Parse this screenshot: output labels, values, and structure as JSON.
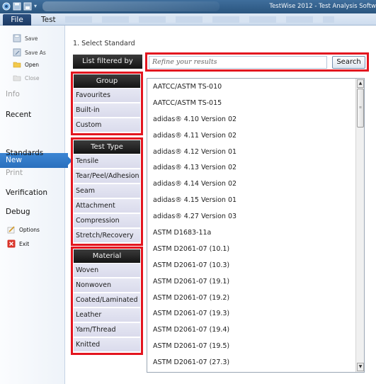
{
  "window": {
    "title": "TestWise 2012 - Test Analysis Softw"
  },
  "tabs": {
    "file": "File",
    "test": "Test"
  },
  "nav": {
    "save": "Save",
    "save_as": "Save As",
    "open": "Open",
    "close": "Close",
    "info": "Info",
    "recent": "Recent",
    "new": "New",
    "standards": "Standards",
    "print": "Print",
    "verification": "Verification",
    "debug": "Debug",
    "options": "Options",
    "exit": "Exit"
  },
  "main": {
    "section_title": "1. Select Standard",
    "filter_label": "List filtered by",
    "search_placeholder": "Refine your results",
    "search_button": "Search"
  },
  "filters": {
    "group": {
      "title": "Group",
      "items": [
        "Favourites",
        "Built-in",
        "Custom"
      ]
    },
    "test_type": {
      "title": "Test Type",
      "items": [
        "Tensile",
        "Tear/Peel/Adhesion",
        "Seam",
        "Attachment",
        "Compression",
        "Stretch/Recovery"
      ]
    },
    "material": {
      "title": "Material",
      "items": [
        "Woven",
        "Nonwoven",
        "Coated/Laminated",
        "Leather",
        "Yarn/Thread",
        "Knitted"
      ]
    }
  },
  "standards_list": [
    "AATCC/ASTM TS-010",
    "AATCC/ASTM TS-015",
    "adidas® 4.10 Version 02",
    "adidas® 4.11 Version 02",
    "adidas® 4.12 Version 01",
    "adidas® 4.13 Version 02",
    "adidas® 4.14 Version 02",
    "adidas® 4.15 Version 01",
    "adidas® 4.27 Version 03",
    "ASTM D1683-11a",
    "ASTM D2061-07 (10.1)",
    "ASTM D2061-07 (10.3)",
    "ASTM D2061-07 (19.1)",
    "ASTM D2061-07 (19.2)",
    "ASTM D2061-07 (19.3)",
    "ASTM D2061-07 (19.4)",
    "ASTM D2061-07 (19.5)",
    "ASTM D2061-07 (27.3)"
  ],
  "colors": {
    "highlight": "#e3151f",
    "nav_selected": "#2f78c7",
    "filter_item_bg": "#e0e1ef",
    "header_bg": "#1f1f1f"
  }
}
